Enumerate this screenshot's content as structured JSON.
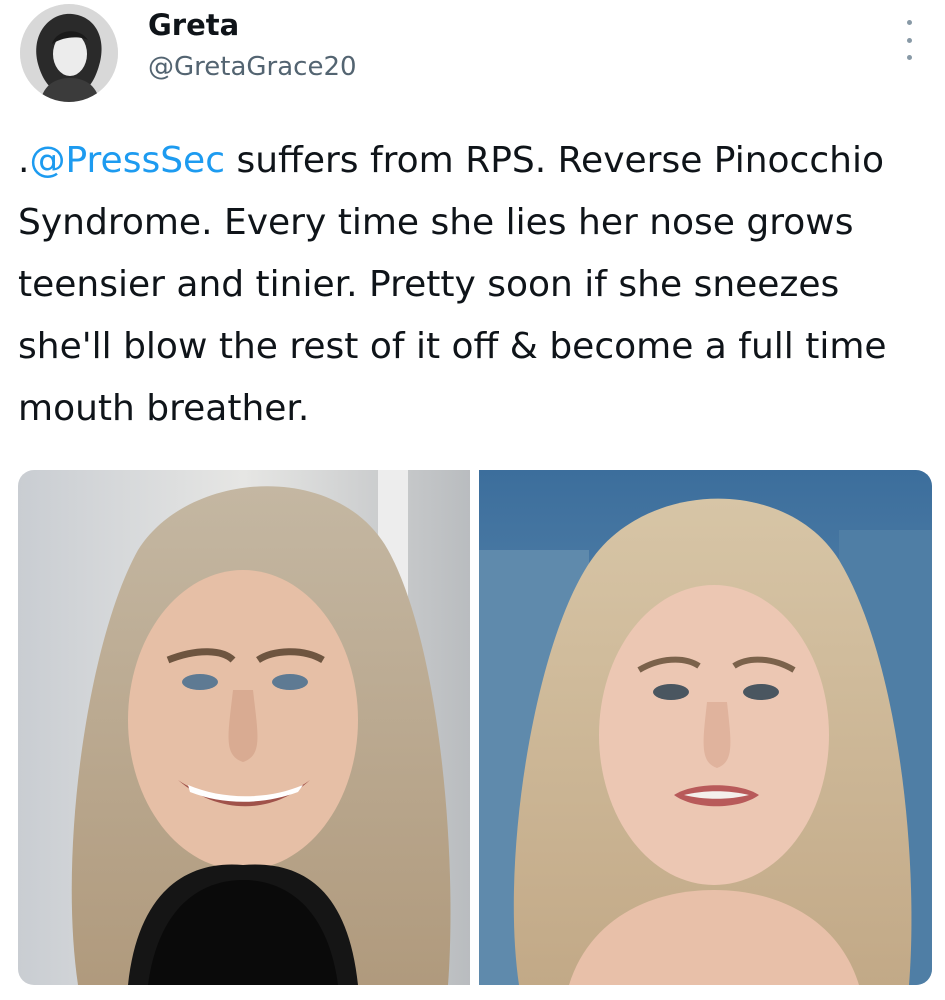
{
  "user": {
    "display_name": "Greta",
    "handle": "@GretaGrace20",
    "avatar_icon": "avatar-portrait"
  },
  "menu": {
    "icon": "more-vertical-icon"
  },
  "tweet": {
    "prefix": ".",
    "mention": "@PressSec",
    "body": " suffers from RPS. Reverse Pinocchio Syndrome. Every time she lies her nose grows teensier and tinier. Pretty soon if she sneezes she'll blow the rest of it off & become a full time mouth breather."
  },
  "media": {
    "photos": [
      {
        "icon": "photo-smiling-woman"
      },
      {
        "icon": "photo-woman-podium"
      }
    ]
  },
  "colors": {
    "mention": "#1d9bf0",
    "text": "#0f1419",
    "secondary": "#536471"
  }
}
